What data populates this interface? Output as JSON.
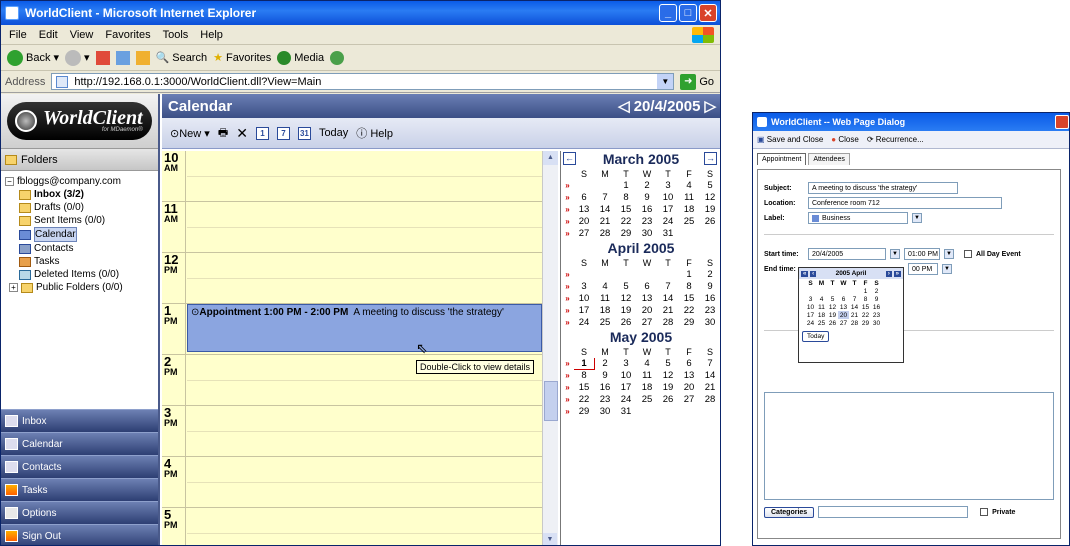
{
  "browser": {
    "title": "WorldClient - Microsoft Internet Explorer",
    "menu": [
      "File",
      "Edit",
      "View",
      "Favorites",
      "Tools",
      "Help"
    ],
    "toolbar": {
      "back": "Back",
      "search": "Search",
      "favorites": "Favorites",
      "media": "Media"
    },
    "address_label": "Address",
    "url": "http://192.168.0.1:3000/WorldClient.dll?View=Main",
    "go": "Go"
  },
  "logo": {
    "name": "WorldClient",
    "sub": "for MDaemon®"
  },
  "folders": {
    "header": "Folders",
    "account": "fbloggs@company.com",
    "items": [
      {
        "label": "Inbox (3/2)",
        "icon": "folder-icon"
      },
      {
        "label": "Drafts (0/0)",
        "icon": "folder-icon"
      },
      {
        "label": "Sent Items (0/0)",
        "icon": "folder-icon"
      },
      {
        "label": "Calendar",
        "icon": "calendar-icon"
      },
      {
        "label": "Contacts",
        "icon": "contacts-icon"
      },
      {
        "label": "Tasks",
        "icon": "tasks-icon"
      },
      {
        "label": "Deleted Items (0/0)",
        "icon": "trash-icon"
      },
      {
        "label": "Public Folders (0/0)",
        "icon": "folder-icon"
      }
    ]
  },
  "nav": [
    "Inbox",
    "Calendar",
    "Contacts",
    "Tasks",
    "Options",
    "Sign Out"
  ],
  "calendar": {
    "title": "Calendar",
    "date": "20/4/2005",
    "tools": {
      "new": "New",
      "today": "Today",
      "help": "Help",
      "d1": "1",
      "d7": "7",
      "d31": "31"
    },
    "hours": [
      {
        "h": "10",
        "ap": "AM"
      },
      {
        "h": "11",
        "ap": "AM"
      },
      {
        "h": "12",
        "ap": "PM"
      },
      {
        "h": "1",
        "ap": "PM"
      },
      {
        "h": "2",
        "ap": "PM"
      },
      {
        "h": "3",
        "ap": "PM"
      },
      {
        "h": "4",
        "ap": "PM"
      },
      {
        "h": "5",
        "ap": "PM"
      }
    ],
    "appointment": {
      "title": "Appointment 1:00 PM - 2:00 PM",
      "desc": "A meeting to discuss 'the strategy'"
    },
    "tooltip": "Double-Click to view details"
  },
  "minical": {
    "dow": [
      "S",
      "M",
      "T",
      "W",
      "T",
      "F",
      "S"
    ],
    "months": [
      {
        "name": "March 2005",
        "weeks": [
          [
            "",
            "",
            "1",
            "2",
            "3",
            "4",
            "5"
          ],
          [
            "6",
            "7",
            "8",
            "9",
            "10",
            "11",
            "12"
          ],
          [
            "13",
            "14",
            "15",
            "16",
            "17",
            "18",
            "19"
          ],
          [
            "20",
            "21",
            "22",
            "23",
            "24",
            "25",
            "26"
          ],
          [
            "27",
            "28",
            "29",
            "30",
            "31",
            "",
            ""
          ]
        ]
      },
      {
        "name": "April 2005",
        "weeks": [
          [
            "",
            "",
            "",
            "",
            "",
            "1",
            "2"
          ],
          [
            "3",
            "4",
            "5",
            "6",
            "7",
            "8",
            "9"
          ],
          [
            "10",
            "11",
            "12",
            "13",
            "14",
            "15",
            "16"
          ],
          [
            "17",
            "18",
            "19",
            "20",
            "21",
            "22",
            "23"
          ],
          [
            "24",
            "25",
            "26",
            "27",
            "28",
            "29",
            "30"
          ]
        ]
      },
      {
        "name": "May 2005",
        "weeks": [
          [
            "1",
            "2",
            "3",
            "4",
            "5",
            "6",
            "7"
          ],
          [
            "8",
            "9",
            "10",
            "11",
            "12",
            "13",
            "14"
          ],
          [
            "15",
            "16",
            "17",
            "18",
            "19",
            "20",
            "21"
          ],
          [
            "22",
            "23",
            "24",
            "25",
            "26",
            "27",
            "28"
          ],
          [
            "29",
            "30",
            "31",
            "",
            "",
            "",
            ""
          ]
        ]
      }
    ]
  },
  "dialog": {
    "title": "WorldClient -- Web Page Dialog",
    "tools": {
      "save": "Save and Close",
      "close": "Close",
      "recurrence": "Recurrence..."
    },
    "tabs": [
      "Appointment",
      "Attendees"
    ],
    "subject_label": "Subject:",
    "subject": "A meeting to discuss 'the strategy'",
    "location_label": "Location:",
    "location": "Conference room 712",
    "label_label": "Label:",
    "label": "Business",
    "start_label": "Start time:",
    "start_date": "20/4/2005",
    "start_time": "01:00 PM",
    "end_label": "End time:",
    "end_time": "00 PM",
    "allday": "All Day Event",
    "picker": {
      "month": "2005 April",
      "dow": [
        "S",
        "M",
        "T",
        "W",
        "T",
        "F",
        "S"
      ],
      "weeks": [
        [
          "",
          "",
          "",
          "",
          "",
          "1",
          "2"
        ],
        [
          "3",
          "4",
          "5",
          "6",
          "7",
          "8",
          "9"
        ],
        [
          "10",
          "11",
          "12",
          "13",
          "14",
          "15",
          "16"
        ],
        [
          "17",
          "18",
          "19",
          "20",
          "21",
          "22",
          "23"
        ],
        [
          "24",
          "25",
          "26",
          "27",
          "28",
          "29",
          "30"
        ]
      ],
      "today": "Today"
    },
    "categories": "Categories",
    "private": "Private"
  }
}
